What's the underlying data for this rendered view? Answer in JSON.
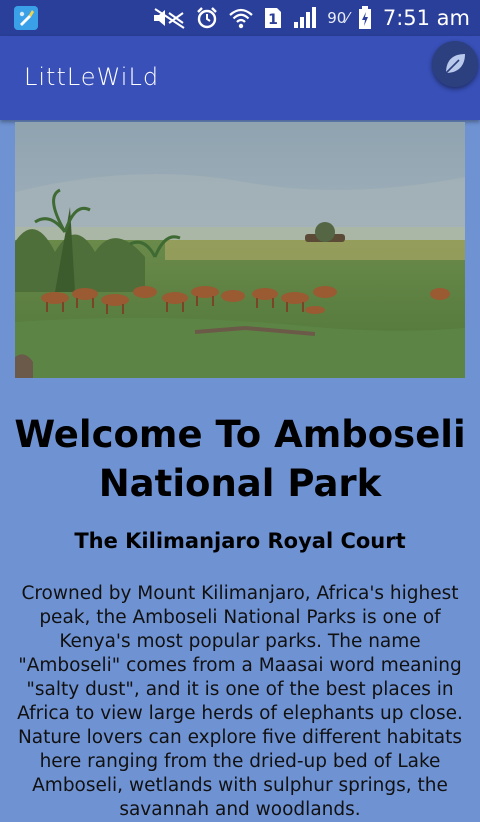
{
  "status_bar": {
    "battery_percent": "90",
    "time": "7:51 am",
    "icons": [
      "launcher-app-icon",
      "mute-icon",
      "alarm-icon",
      "wifi-icon",
      "sim-1-icon",
      "signal-icon",
      "battery-charging-icon"
    ]
  },
  "app_bar": {
    "title": "LittLeWiLd",
    "fab_icon": "leaf-icon"
  },
  "hero": {
    "image": "antelope herd grazing on savanna grassland"
  },
  "content": {
    "heading": "Welcome To Amboseli National Park",
    "subheading": "The Kilimanjaro Royal Court",
    "body": "Crowned by Mount Kilimanjaro, Africa's highest peak, the Amboseli National Parks is one of Kenya's most popular parks. The name \"Amboseli\" comes from a Maasai word meaning \"salty dust\", and it is one of the best places in Africa to view large herds of elephants up close. Nature lovers can explore five different habitats here ranging from the dried-up bed of Lake Amboseli, wetlands with sulphur springs, the savannah and woodlands."
  },
  "colors": {
    "status_bar": "#2a3f99",
    "app_bar": "#3850b8",
    "fab": "#2c3f7e",
    "page_background": "#6f92d3"
  }
}
